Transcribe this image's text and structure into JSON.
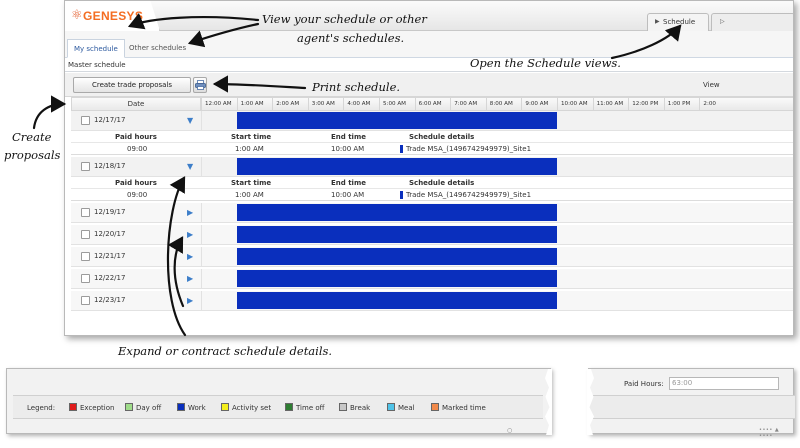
{
  "app": {
    "logo": "GENESYS"
  },
  "tabs": {
    "schedule": "Schedule"
  },
  "subtabs": {
    "my_schedule": "My schedule",
    "other_schedules": "Other schedules"
  },
  "section": {
    "title": "Master schedule"
  },
  "toolbar": {
    "trade_button": "Create trade proposals",
    "view_label": "View"
  },
  "grid": {
    "date_header": "Date",
    "times": [
      "12:00 AM",
      "1:00 AM",
      "2:00 AM",
      "3:00 AM",
      "4:00 AM",
      "5:00 AM",
      "6:00 AM",
      "7:00 AM",
      "8:00 AM",
      "9:00 AM",
      "10:00 AM",
      "11:00 AM",
      "12:00 PM",
      "1:00 PM",
      "2:00"
    ],
    "detail_headers": {
      "paid_hours": "Paid hours",
      "start_time": "Start time",
      "end_time": "End time",
      "schedule_details": "Schedule details"
    },
    "rows": [
      {
        "date": "12/17/17",
        "expanded": true,
        "shift_start_hour": 1,
        "shift_end_hour": 10,
        "detail": {
          "paid_hours": "09:00",
          "start_time": "1:00 AM",
          "end_time": "10:00 AM",
          "schedule_details": "Trade MSA_(1496742949979)_Site1"
        }
      },
      {
        "date": "12/18/17",
        "expanded": true,
        "shift_start_hour": 1,
        "shift_end_hour": 10,
        "detail": {
          "paid_hours": "09:00",
          "start_time": "1:00 AM",
          "end_time": "10:00 AM",
          "schedule_details": "Trade MSA_(1496742949979)_Site1"
        }
      },
      {
        "date": "12/19/17",
        "expanded": false,
        "shift_start_hour": 1,
        "shift_end_hour": 10
      },
      {
        "date": "12/20/17",
        "expanded": false,
        "shift_start_hour": 1,
        "shift_end_hour": 10
      },
      {
        "date": "12/21/17",
        "expanded": false,
        "shift_start_hour": 1,
        "shift_end_hour": 10
      },
      {
        "date": "12/22/17",
        "expanded": false,
        "shift_start_hour": 1,
        "shift_end_hour": 10
      },
      {
        "date": "12/23/17",
        "expanded": false,
        "shift_start_hour": 1,
        "shift_end_hour": 10
      }
    ]
  },
  "annotations": {
    "view_schedule": "View your schedule or other",
    "view_schedule_2": "agent's schedules.",
    "open_views": "Open the Schedule views.",
    "print": "Print schedule.",
    "create_1": "Create",
    "create_2": "proposals",
    "expand": "Expand or contract schedule details."
  },
  "legend": {
    "title": "Legend:",
    "items": [
      {
        "label": "Exception",
        "color": "#e01b1b"
      },
      {
        "label": "Day off",
        "color": "#9fdc8a"
      },
      {
        "label": "Work",
        "color": "#0a2fbd"
      },
      {
        "label": "Activity set",
        "color": "#f4ef1c"
      },
      {
        "label": "Time off",
        "color": "#2e7d32"
      },
      {
        "label": "Break",
        "color": "#c8c8c8"
      },
      {
        "label": "Meal",
        "color": "#4fc3e8"
      },
      {
        "label": "Marked time",
        "color": "#f28a4b"
      }
    ]
  },
  "paid_hours": {
    "label": "Paid Hours:",
    "value": "63:00"
  },
  "colors": {
    "work_bar": "#0a2fbd",
    "accent": "#2d5a9f",
    "brand": "#f46d22"
  }
}
